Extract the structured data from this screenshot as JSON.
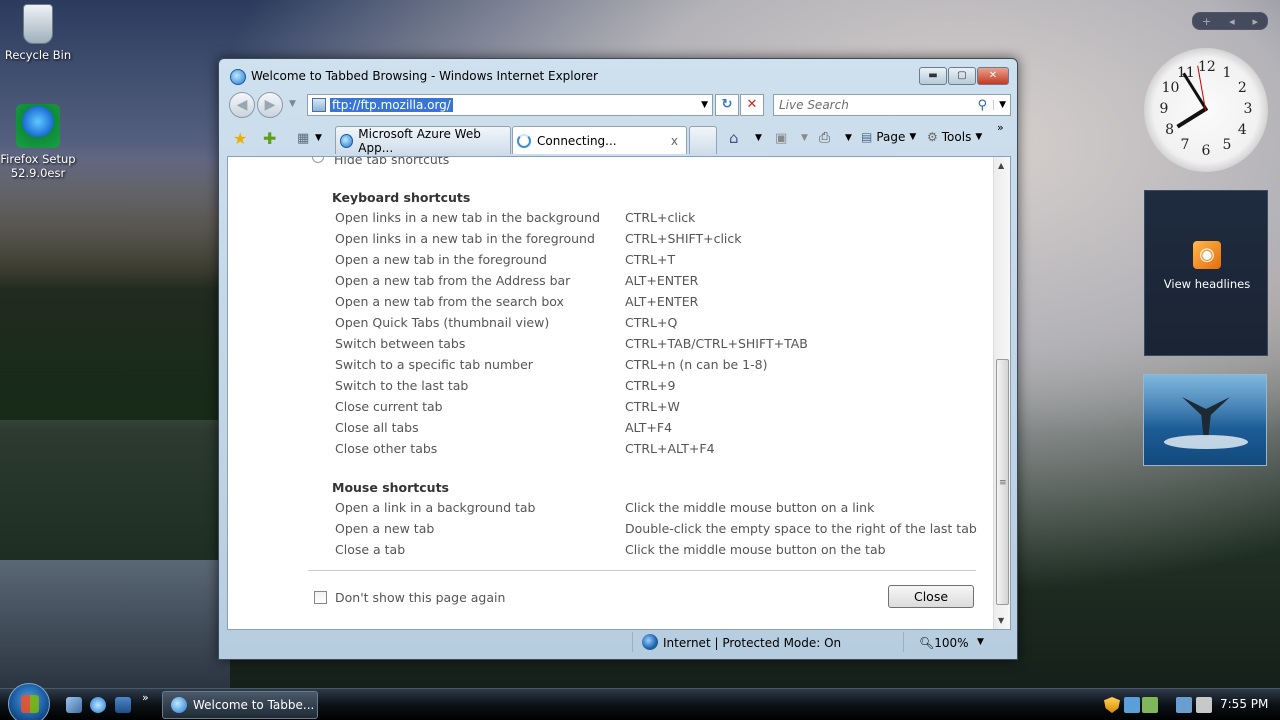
{
  "desktop": {
    "icons": [
      {
        "label": "Recycle Bin"
      },
      {
        "label": "Firefox Setup\n52.9.0esr"
      }
    ]
  },
  "window": {
    "title": "Welcome to Tabbed Browsing - Windows Internet Explorer",
    "buttons": {
      "minimize": "▬",
      "maximize": "▢",
      "close": "✕"
    }
  },
  "navbar": {
    "back": "◀",
    "forward": "▶",
    "address": "ftp://ftp.mozilla.org/",
    "refresh": "↻",
    "stop": "✕",
    "search_placeholder": "Live Search",
    "search_icon": "⚲"
  },
  "tabs": [
    {
      "label": "Microsoft Azure Web App...",
      "active": false
    },
    {
      "label": "Connecting...",
      "active": true,
      "close": "x"
    }
  ],
  "command_bar": {
    "page": "Page",
    "tools": "Tools"
  },
  "page": {
    "hidden_option": "Hide tab shortcuts",
    "keyboard_title": "Keyboard shortcuts",
    "keyboard": [
      {
        "action": "Open links in a new tab in the background",
        "key": "CTRL+click"
      },
      {
        "action": "Open links in a new tab in the foreground",
        "key": "CTRL+SHIFT+click"
      },
      {
        "action": "Open a new tab in the foreground",
        "key": "CTRL+T"
      },
      {
        "action": "Open a new tab from the Address bar",
        "key": "ALT+ENTER"
      },
      {
        "action": "Open a new tab from the search box",
        "key": "ALT+ENTER"
      },
      {
        "action": "Open Quick Tabs (thumbnail view)",
        "key": "CTRL+Q"
      },
      {
        "action": "Switch between tabs",
        "key": "CTRL+TAB/CTRL+SHIFT+TAB"
      },
      {
        "action": "Switch to a specific tab number",
        "key": "CTRL+n (n can be 1-8)"
      },
      {
        "action": "Switch to the last tab",
        "key": "CTRL+9"
      },
      {
        "action": "Close current tab",
        "key": "CTRL+W"
      },
      {
        "action": "Close all tabs",
        "key": "ALT+F4"
      },
      {
        "action": "Close other tabs",
        "key": "CTRL+ALT+F4"
      }
    ],
    "mouse_title": "Mouse shortcuts",
    "mouse": [
      {
        "action": "Open a link in a background tab",
        "key": "Click the middle mouse button on a link"
      },
      {
        "action": "Open a new tab",
        "key": "Double-click the empty space to the right of the last tab"
      },
      {
        "action": "Close a tab",
        "key": "Click the middle mouse button on the tab"
      }
    ],
    "dont_show": "Don't show this page again",
    "close_button": "Close"
  },
  "statusbar": {
    "zone": "Internet | Protected Mode: On",
    "zoom": "100%"
  },
  "gadgets": {
    "clock_numbers": [
      "12",
      "1",
      "2",
      "3",
      "4",
      "5",
      "6",
      "7",
      "8",
      "9",
      "10",
      "11"
    ],
    "feed_label": "View headlines",
    "toolbar": {
      "add": "+",
      "prev": "◂",
      "next": "▸"
    }
  },
  "taskbar": {
    "task_label": "Welcome to Tabbe...",
    "time": "7:55 PM"
  }
}
